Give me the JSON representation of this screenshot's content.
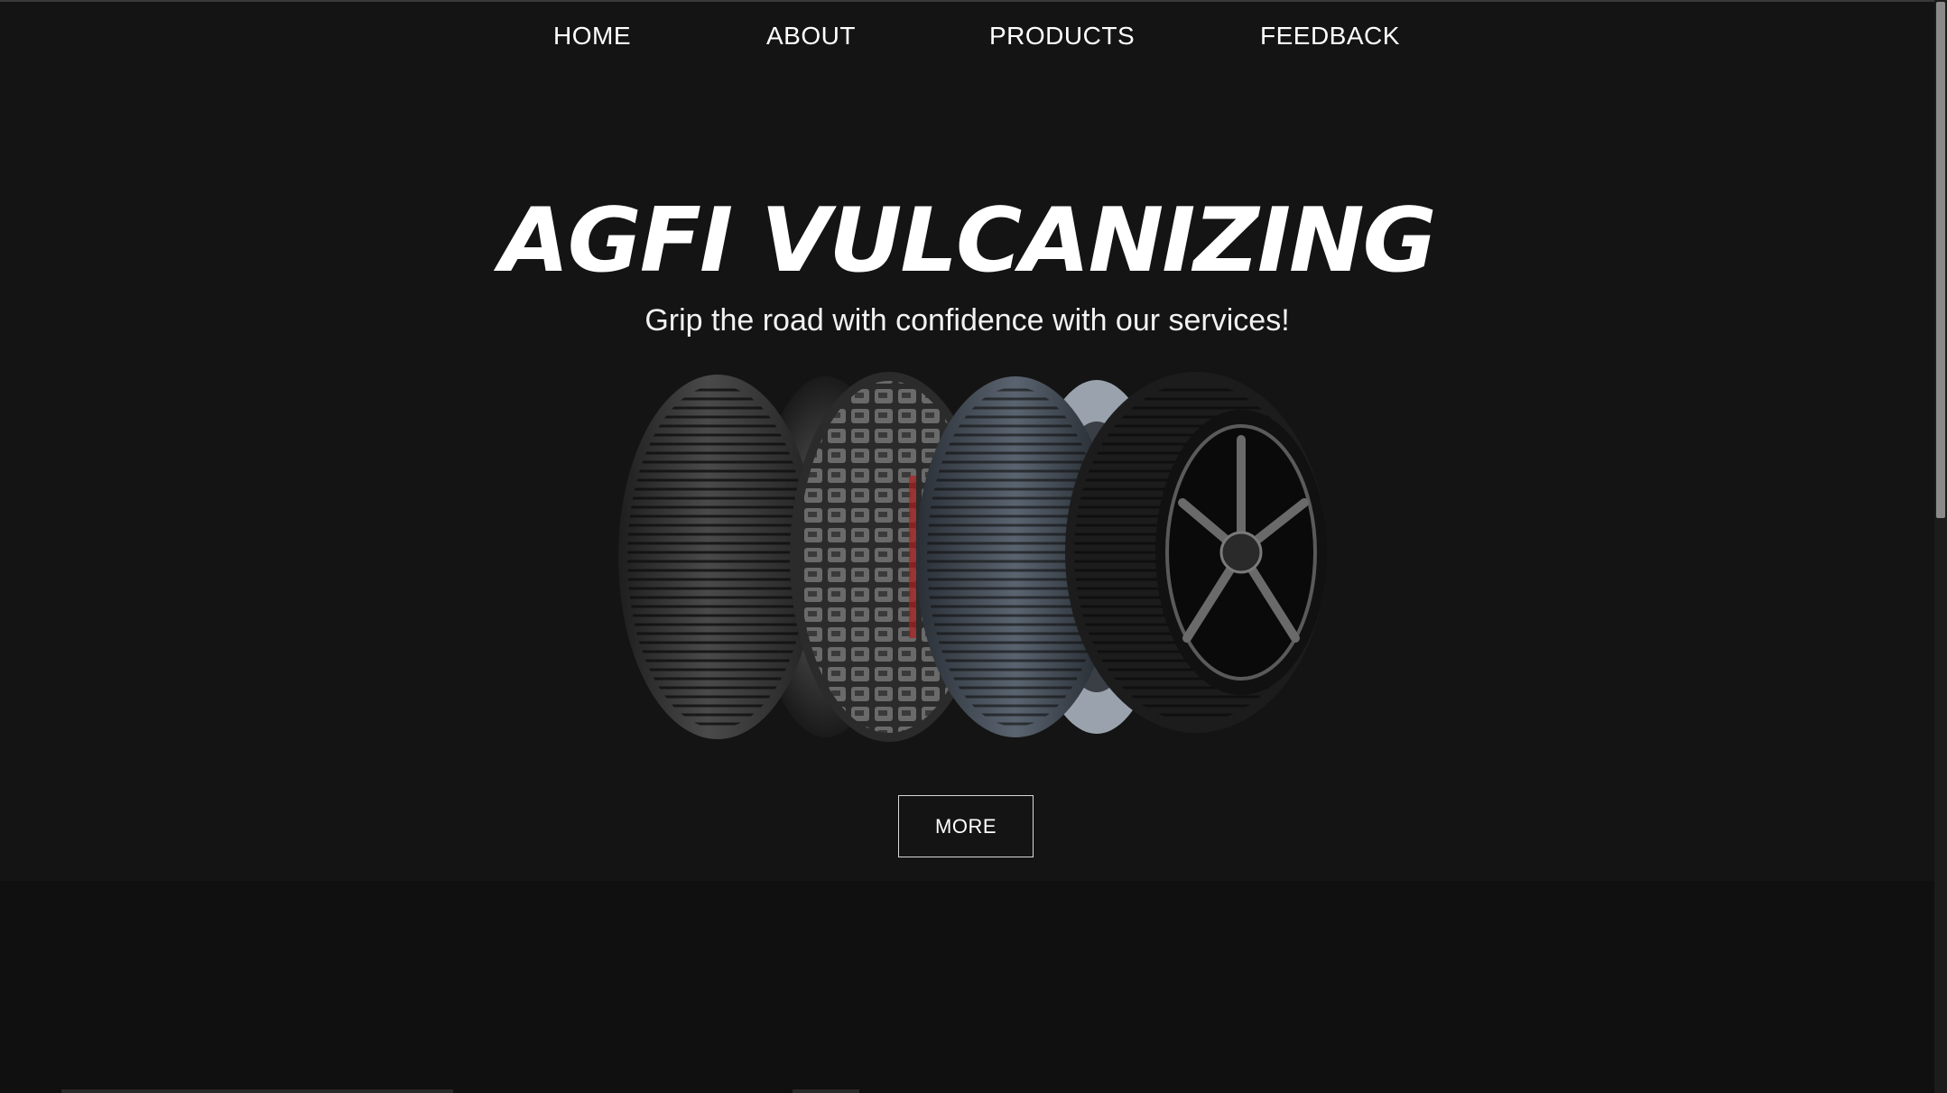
{
  "nav": {
    "items": [
      {
        "label": "HOME"
      },
      {
        "label": "ABOUT"
      },
      {
        "label": "PRODUCTS"
      },
      {
        "label": "FEEDBACK"
      }
    ]
  },
  "hero": {
    "title": "AGFI VULCANIZING",
    "subtitle": "Grip the road with confidence with our services!",
    "more_label": "MORE"
  },
  "colors": {
    "background": "#141414",
    "section_below": "#101010",
    "text": "#ffffff"
  }
}
